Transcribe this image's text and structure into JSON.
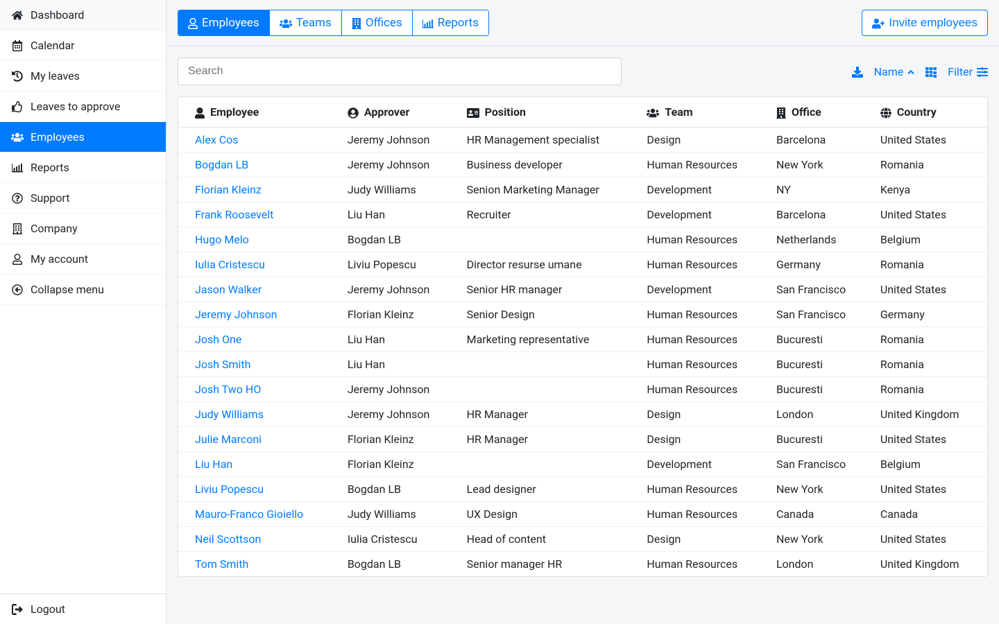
{
  "sidebar": {
    "items": [
      {
        "label": "Dashboard"
      },
      {
        "label": "Calendar"
      },
      {
        "label": "My leaves"
      },
      {
        "label": "Leaves to approve"
      },
      {
        "label": "Employees"
      },
      {
        "label": "Reports"
      },
      {
        "label": "Support"
      },
      {
        "label": "Company"
      },
      {
        "label": "My account"
      },
      {
        "label": "Collapse menu"
      }
    ],
    "logout": "Logout"
  },
  "tabs": {
    "employees": "Employees",
    "teams": "Teams",
    "offices": "Offices",
    "reports": "Reports"
  },
  "buttons": {
    "invite": "Invite employees"
  },
  "search": {
    "placeholder": "Search"
  },
  "toolbar": {
    "name": "Name",
    "filter": "Filter"
  },
  "table": {
    "headers": {
      "employee": "Employee",
      "approver": "Approver",
      "position": "Position",
      "team": "Team",
      "office": "Office",
      "country": "Country"
    },
    "rows": [
      {
        "employee": "Alex Cos",
        "approver": "Jeremy Johnson",
        "position": "HR Management specialist",
        "team": "Design",
        "office": "Barcelona",
        "country": "United States"
      },
      {
        "employee": "Bogdan LB",
        "approver": "Jeremy Johnson",
        "position": "Business developer",
        "team": "Human Resources",
        "office": "New York",
        "country": "Romania"
      },
      {
        "employee": "Florian Kleinz",
        "approver": "Judy Williams",
        "position": "Senion Marketing Manager",
        "team": "Development",
        "office": "NY",
        "country": "Kenya"
      },
      {
        "employee": "Frank Roosevelt",
        "approver": "Liu Han",
        "position": "Recruiter",
        "team": "Development",
        "office": "Barcelona",
        "country": "United States"
      },
      {
        "employee": "Hugo Melo",
        "approver": "Bogdan LB",
        "position": "",
        "team": "Human Resources",
        "office": "Netherlands",
        "country": "Belgium"
      },
      {
        "employee": "Iulia Cristescu",
        "approver": "Liviu Popescu",
        "position": "Director resurse umane",
        "team": "Human Resources",
        "office": "Germany",
        "country": "Romania"
      },
      {
        "employee": "Jason Walker",
        "approver": "Jeremy Johnson",
        "position": "Senior HR manager",
        "team": "Development",
        "office": "San Francisco",
        "country": "United States"
      },
      {
        "employee": "Jeremy Johnson",
        "approver": "Florian Kleinz",
        "position": "Senior Design",
        "team": "Human Resources",
        "office": "San Francisco",
        "country": "Germany"
      },
      {
        "employee": "Josh One",
        "approver": "Liu Han",
        "position": "Marketing representative",
        "team": "Human Resources",
        "office": "Bucuresti",
        "country": "Romania"
      },
      {
        "employee": "Josh Smith",
        "approver": "Liu Han",
        "position": "",
        "team": "Human Resources",
        "office": "Bucuresti",
        "country": "Romania"
      },
      {
        "employee": "Josh Two HO",
        "approver": "Jeremy Johnson",
        "position": "",
        "team": "Human Resources",
        "office": "Bucuresti",
        "country": "Romania"
      },
      {
        "employee": "Judy Williams",
        "approver": "Jeremy Johnson",
        "position": "HR Manager",
        "team": "Design",
        "office": "London",
        "country": "United Kingdom"
      },
      {
        "employee": "Julie Marconi",
        "approver": "Florian Kleinz",
        "position": "HR Manager",
        "team": "Design",
        "office": "Bucuresti",
        "country": "United States"
      },
      {
        "employee": "Liu Han",
        "approver": "Florian Kleinz",
        "position": "",
        "team": "Development",
        "office": "San Francisco",
        "country": "Belgium"
      },
      {
        "employee": "Liviu Popescu",
        "approver": "Bogdan LB",
        "position": "Lead designer",
        "team": "Human Resources",
        "office": "New York",
        "country": "United States"
      },
      {
        "employee": "Mauro-Franco Gioiello",
        "approver": "Judy Williams",
        "position": "UX Design",
        "team": "Human Resources",
        "office": "Canada",
        "country": "Canada"
      },
      {
        "employee": "Neil Scottson",
        "approver": "Iulia Cristescu",
        "position": "Head of content",
        "team": "Design",
        "office": "New York",
        "country": "United States"
      },
      {
        "employee": "Tom Smith",
        "approver": "Bogdan LB",
        "position": "Senior manager HR",
        "team": "Human Resources",
        "office": "London",
        "country": "United Kingdom"
      }
    ]
  }
}
